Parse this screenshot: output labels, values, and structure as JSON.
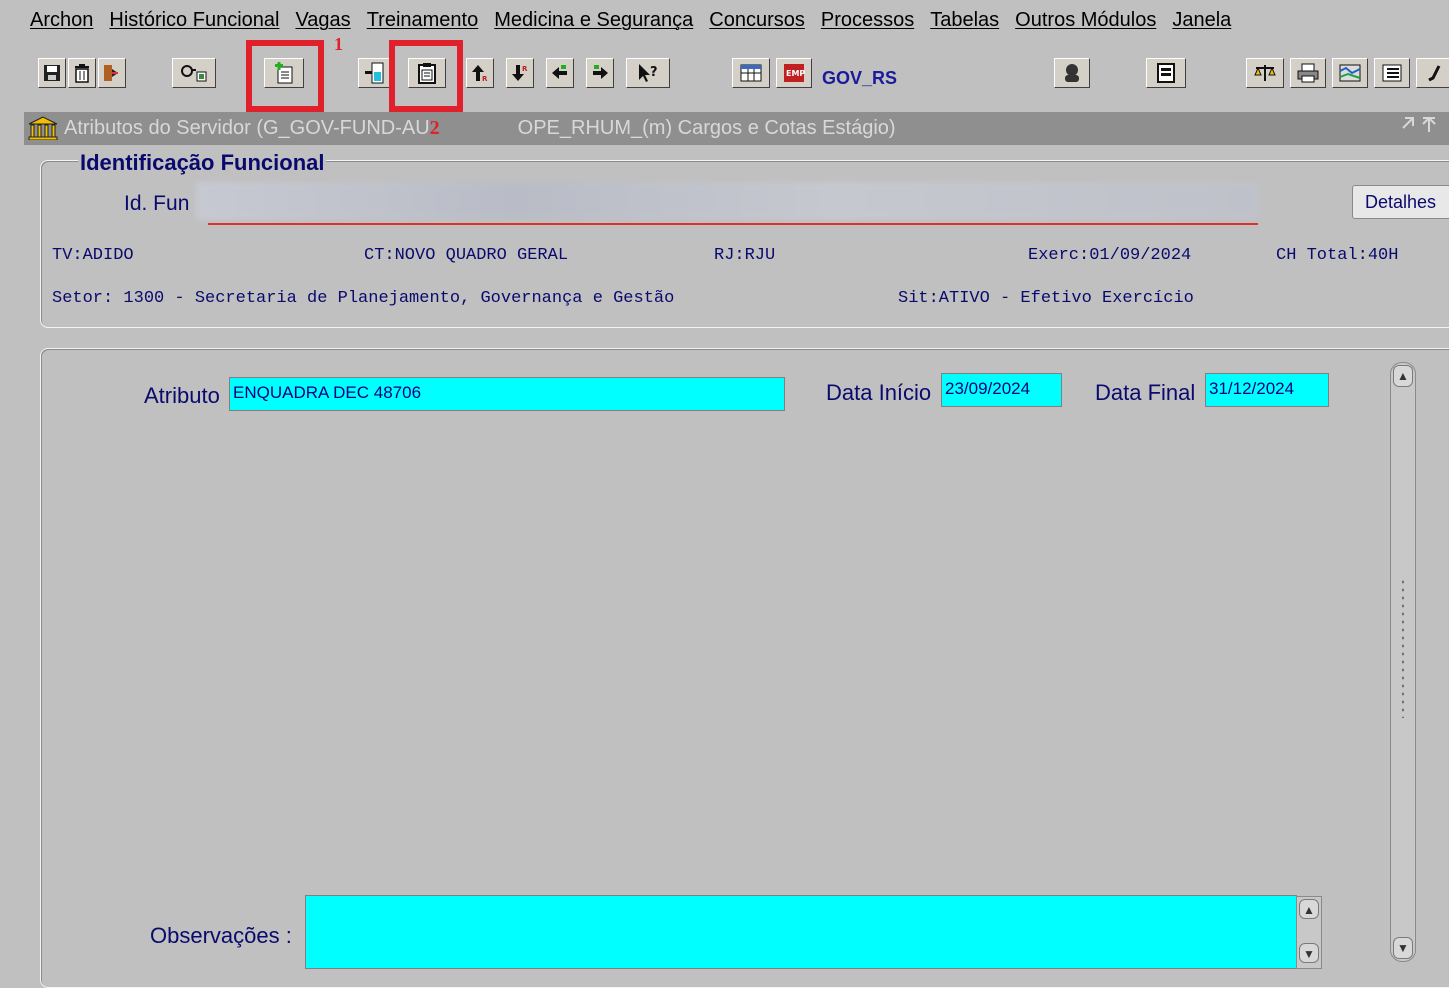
{
  "menu": [
    "Archon",
    "Histórico Funcional",
    "Vagas",
    "Treinamento",
    "Medicina e Segurança",
    "Concursos",
    "Processos",
    "Tabelas",
    "Outros Módulos",
    "Janela"
  ],
  "toolbar": {
    "env_label": "GOV_RS",
    "annotation_1": "1",
    "annotation_2": "2",
    "annotation_color": "#e0202a"
  },
  "window": {
    "title_left": "Atributos do Servidor (G_GOV-FUND-AU",
    "title_right": "OPE_RHUM_(m) Cargos e Cotas Estágio)"
  },
  "identificacao": {
    "section_title": "Identificação Funcional",
    "id_label": "Id. Fun",
    "details_button": "Detalhes",
    "tv": "TV:ADIDO",
    "ct": "CT:NOVO QUADRO GERAL",
    "rj": "RJ:RJU",
    "exerc": "Exerc:01/09/2024",
    "ch_total": "CH Total:40H",
    "setor": "Setor: 1300 - Secretaria de Planejamento, Governança e Gestão",
    "sit": "Sit:ATIVO - Efetivo Exercício"
  },
  "form": {
    "atributo_label": "Atributo",
    "atributo_value": "ENQUADRA DEC 48706",
    "data_inicio_label": "Data Início",
    "data_inicio_value": "23/09/2024",
    "data_final_label": "Data Final",
    "data_final_value": "31/12/2024",
    "observacoes_label": "Observações :",
    "observacoes_value": ""
  },
  "colors": {
    "field_bg": "#00ffff",
    "label_text": "#0a0a6e",
    "window_bg": "#c0c0c0"
  }
}
